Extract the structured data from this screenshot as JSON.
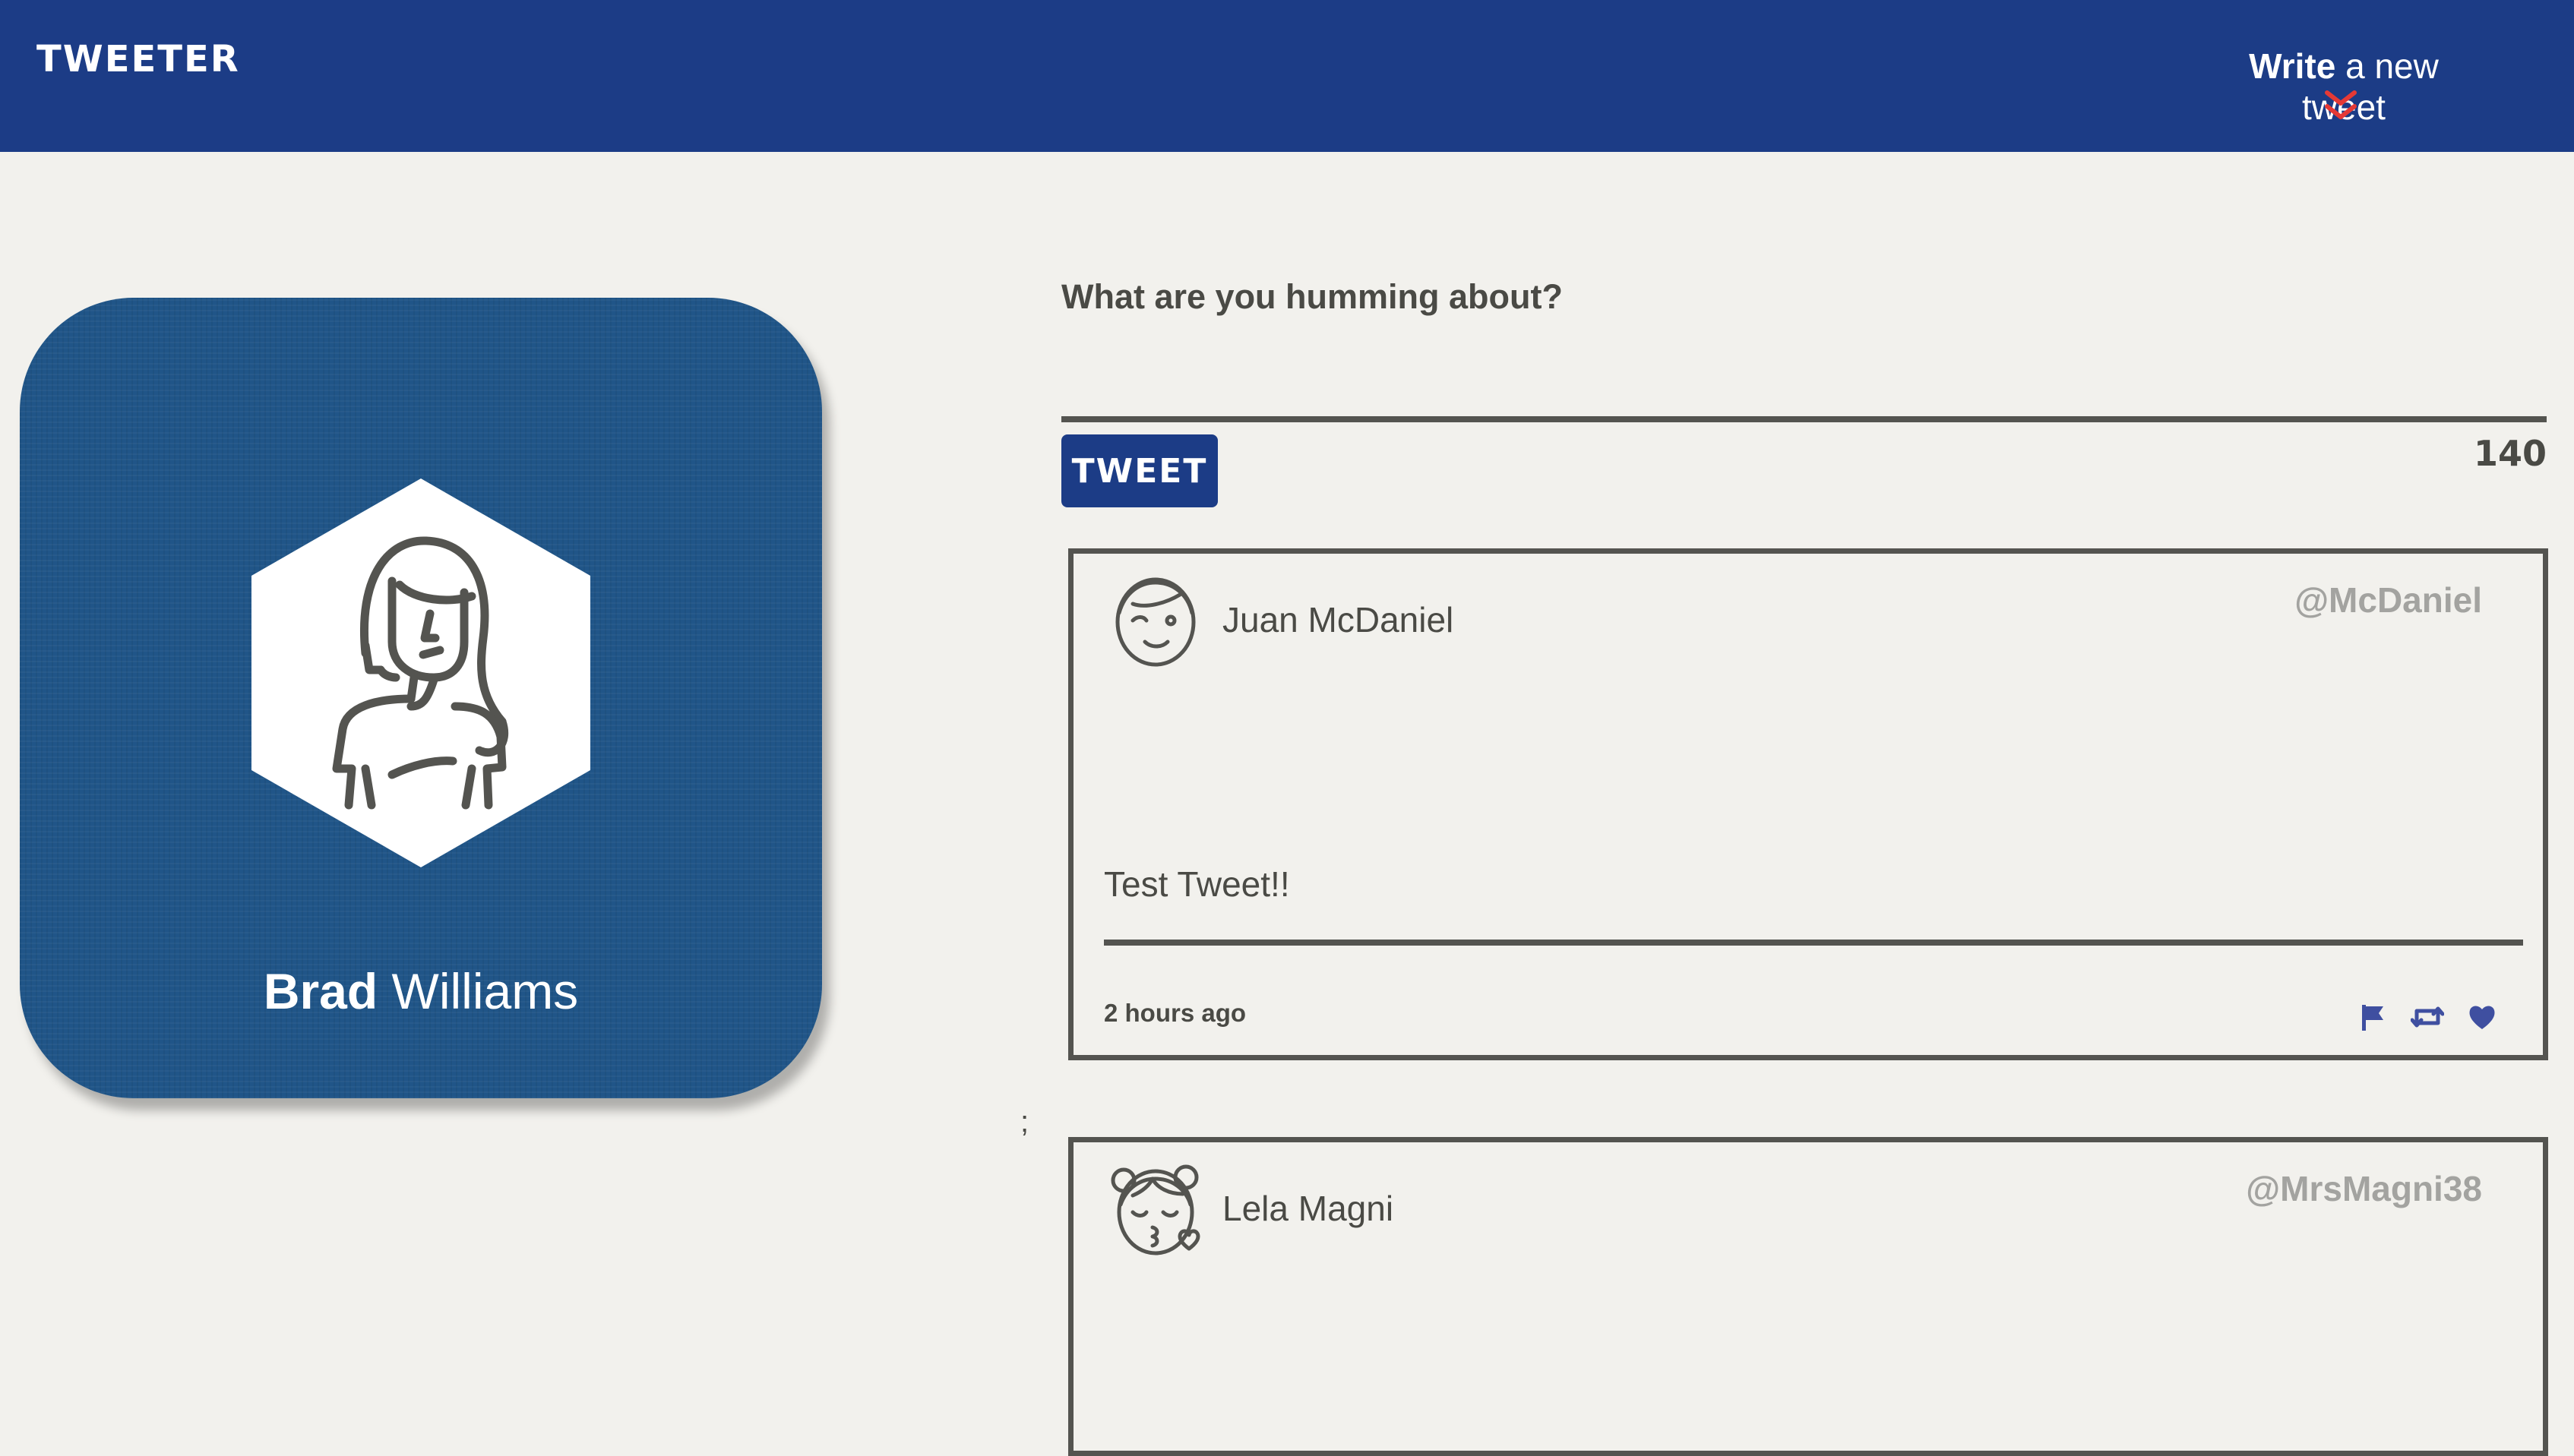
{
  "nav": {
    "brand": "TWEETER",
    "compose_strong": "Write",
    "compose_rest": " a new tweet",
    "chevron_icon": "double-chevron-down-icon",
    "chevron_color": "#e53935"
  },
  "profile": {
    "avatar_icon": "woman-avatar-icon",
    "first_name": "Brad",
    "last_name": " Williams"
  },
  "composer": {
    "prompt": "What are you humming about?",
    "text": "",
    "button_label": "TWEET",
    "counter": "140"
  },
  "tweets": [
    {
      "avatar_icon": "winking-boy-avatar-icon",
      "name": "Juan McDaniel",
      "handle": "@McDaniel",
      "content": "Test Tweet!!",
      "time": "2 hours ago",
      "actions": [
        "flag-icon",
        "retweet-icon",
        "heart-icon"
      ]
    },
    {
      "avatar_icon": "kissing-girl-avatar-icon",
      "name": "Lela Magni",
      "handle": "@MrsMagni38"
    }
  ],
  "stray_text": ";",
  "colors": {
    "nav_bg": "#1c3c86",
    "profile_bg": "#205588",
    "page_bg": "#f2f1ed",
    "text": "#4a4a45",
    "handle": "#a3a3a0",
    "action_icons": "#3f4fa0"
  }
}
